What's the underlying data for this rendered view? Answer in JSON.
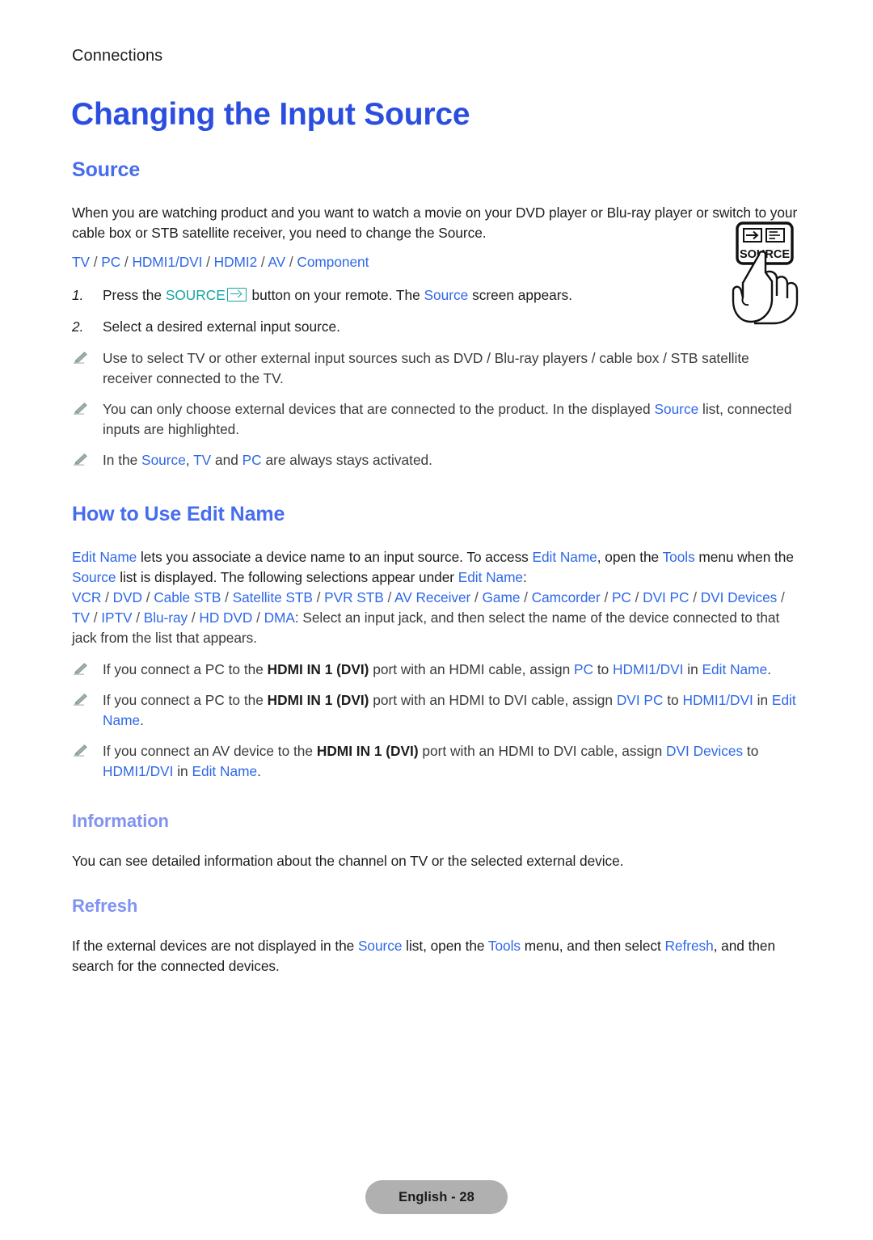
{
  "breadcrumb": "Connections",
  "page_title": "Changing the Input Source",
  "sections": {
    "source": {
      "heading": "Source",
      "intro": "When you are watching product and you want to watch a movie on your DVD player or Blu-ray player or switch to your cable box or STB satellite receiver, you need to change the Source.",
      "source_list": {
        "items": [
          "TV",
          "PC",
          "HDMI1/DVI",
          "HDMI2",
          "AV",
          "Component"
        ],
        "separator": " / "
      },
      "steps": [
        {
          "number": "1.",
          "pre": "Press the ",
          "key": "SOURCE",
          "post": " button on your remote. The ",
          "link": "Source",
          "tail": " screen appears."
        },
        {
          "number": "2.",
          "text": "Select a desired external input source."
        }
      ],
      "notes": [
        {
          "icon": "pencil-icon",
          "text": "Use to select TV or other external input sources such as DVD / Blu-ray players / cable box / STB satellite receiver connected to the TV."
        },
        {
          "icon": "pencil-icon",
          "pre": "You can only choose external devices that are connected to the product. In the displayed ",
          "link": "Source",
          "post": " list, connected inputs are highlighted."
        },
        {
          "icon": "pencil-icon",
          "pre": "In the ",
          "link1": "Source",
          "mid1": ", ",
          "link2": "TV",
          "mid2": " and ",
          "link3": "PC",
          "post": " are always stays activated."
        }
      ]
    },
    "edit_name": {
      "heading": "How to Use Edit Name",
      "intro_parts": {
        "l1": "Edit Name",
        "t1": " lets you associate a device name to an input source. To access ",
        "l2": "Edit Name",
        "t2": ", open the ",
        "l3": "Tools",
        "t3": " menu when the ",
        "l4": "Source",
        "t4": " list is displayed. The following selections appear under ",
        "l5": "Edit Name",
        "t5": ":"
      },
      "device_list": {
        "items": [
          "VCR",
          "DVD",
          "Cable STB",
          "Satellite STB",
          "PVR STB",
          "AV Receiver",
          "Game",
          "Camcorder",
          "PC",
          "DVI PC",
          "DVI Devices",
          "TV",
          "IPTV",
          "Blu-ray",
          "HD DVD",
          "DMA"
        ],
        "separator": " / ",
        "tail": ": Select an input jack, and then select the name of the device connected to that jack from the list that appears."
      },
      "notes": [
        {
          "icon": "pencil-icon",
          "t1": "If you connect a PC to the ",
          "b1": "HDMI IN 1 (DVI)",
          "t2": " port with an HDMI cable, assign ",
          "l1": "PC",
          "t3": " to ",
          "l2": "HDMI1/DVI",
          "t4": " in ",
          "l3": "Edit Name",
          "t5": "."
        },
        {
          "icon": "pencil-icon",
          "t1": "If you connect a PC to the ",
          "b1": "HDMI IN 1 (DVI)",
          "t2": " port with an HDMI to DVI cable, assign ",
          "l1": "DVI PC",
          "t3": " to ",
          "l2": "HDMI1/DVI",
          "t4": " in ",
          "l3": "Edit Name",
          "t5": "."
        },
        {
          "icon": "pencil-icon",
          "t1": "If you connect an AV device to the ",
          "b1": "HDMI IN 1 (DVI)",
          "t2": " port with an HDMI to DVI cable, assign ",
          "l1": "DVI Devices",
          "t3": " to ",
          "l2": "HDMI1/DVI",
          "t4": " in ",
          "l3": "Edit Name",
          "t5": "."
        }
      ]
    },
    "information": {
      "heading": "Information",
      "text": "You can see detailed information about the channel on TV or the selected external device."
    },
    "refresh": {
      "heading": "Refresh",
      "t1": "If the external devices are not displayed in the ",
      "l1": "Source",
      "t2": " list, open the ",
      "l2": "Tools",
      "t3": " menu, and then select ",
      "l3": "Refresh",
      "t4": ", and then search for the connected devices."
    }
  },
  "remote": {
    "button_label": "SOURCE",
    "icons": [
      "source-arrow-icon",
      "menu-list-icon"
    ],
    "hand": "hand-pressing-illustration"
  },
  "footer": {
    "label": "English - 28"
  },
  "colors": {
    "heading_primary": "#2b4ee0",
    "heading_secondary": "#466ded",
    "heading_tertiary": "#8193f2",
    "link": "#2f68e8",
    "key_teal": "#19a3a3",
    "footer_bg": "#b0b0b0",
    "body_text": "#1d1d1d"
  }
}
